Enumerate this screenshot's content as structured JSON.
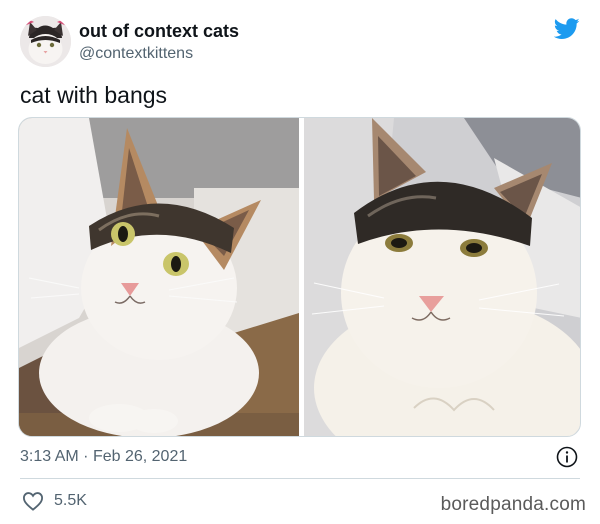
{
  "author": {
    "display_name": "out of context cats",
    "handle": "@contextkittens"
  },
  "tweet": {
    "text": "cat with bangs",
    "time": "3:13 AM",
    "separator": "·",
    "date": "Feb 26, 2021"
  },
  "engagement": {
    "likes": "5.5K"
  },
  "watermark": "boredpanda.com",
  "colors": {
    "twitter_blue": "#1d9bf0",
    "secondary_text": "#536471",
    "primary_text": "#0f1419",
    "border": "#cfd9de"
  },
  "icons": {
    "brand": "twitter-bird-icon",
    "info": "info-icon",
    "like": "heart-icon"
  }
}
